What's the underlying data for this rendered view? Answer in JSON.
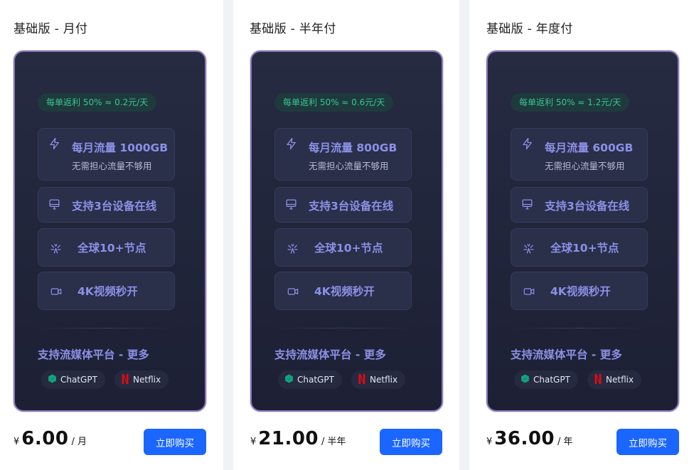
{
  "plans": [
    {
      "title": "基础版 - 月付",
      "rebate": "每单返利 50% ≈ 0.2元/天",
      "features": {
        "traffic": "每月流量 1000GB",
        "traffic_sub": "无需担心流量不够用",
        "devices": "支持3台设备在线",
        "nodes": "全球10+节点",
        "video": "4K视频秒开"
      },
      "streaming_title": "支持流媒体平台 - 更多",
      "platforms": [
        "ChatGPT",
        "Netflix"
      ],
      "currency": "¥",
      "price": "6.00",
      "period": "/ 月",
      "buy_label": "立即购买"
    },
    {
      "title": "基础版 - 半年付",
      "rebate": "每单返利 50% ≈ 0.6元/天",
      "features": {
        "traffic": "每月流量 800GB",
        "traffic_sub": "无需担心流量不够用",
        "devices": "支持3台设备在线",
        "nodes": "全球10+节点",
        "video": "4K视频秒开"
      },
      "streaming_title": "支持流媒体平台 - 更多",
      "platforms": [
        "ChatGPT",
        "Netflix"
      ],
      "currency": "¥",
      "price": "21.00",
      "period": "/ 半年",
      "buy_label": "立即购买"
    },
    {
      "title": "基础版 - 年度付",
      "rebate": "每单返利 50% ≈ 1.2元/天",
      "features": {
        "traffic": "每月流量 600GB",
        "traffic_sub": "无需担心流量不够用",
        "devices": "支持3台设备在线",
        "nodes": "全球10+节点",
        "video": "4K视频秒开"
      },
      "streaming_title": "支持流媒体平台 - 更多",
      "platforms": [
        "ChatGPT",
        "Netflix"
      ],
      "currency": "¥",
      "price": "36.00",
      "period": "/ 年",
      "buy_label": "立即购买"
    }
  ],
  "colors": {
    "accent": "#8b90e6",
    "rebate_text": "#3cc392",
    "buy_button": "#1a66ff",
    "card_border": "#8a79b8",
    "chatgpt_icon": "#10a37f",
    "netflix_icon": "#e50914"
  },
  "icons": {
    "traffic": "lightning-icon",
    "devices": "monitor-icon",
    "nodes": "network-nodes-icon",
    "video": "video-camera-icon",
    "chatgpt": "chatgpt-logo-icon",
    "netflix": "netflix-logo-icon"
  }
}
